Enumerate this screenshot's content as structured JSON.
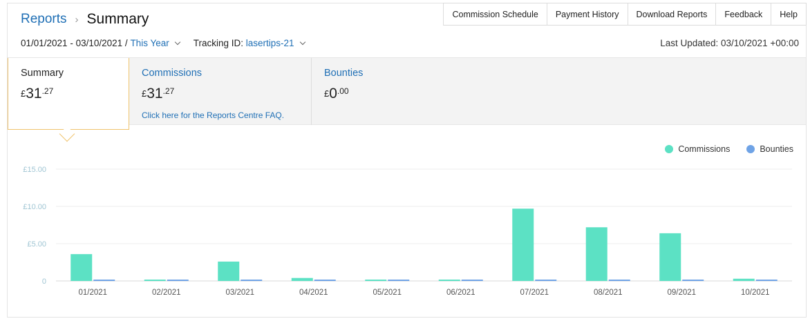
{
  "header": {
    "breadcrumb_link": "Reports",
    "breadcrumb_separator": "›",
    "page_title": "Summary",
    "links": [
      "Commission Schedule",
      "Payment History",
      "Download Reports",
      "Feedback",
      "Help"
    ]
  },
  "filters": {
    "date_range": "01/01/2021 - 03/10/2021",
    "slash": "/",
    "period_label": "This Year",
    "tracking_label": "Tracking ID:",
    "tracking_id": "lasertips-21",
    "last_updated": "Last Updated: 03/10/2021 +00:00"
  },
  "tabs": {
    "summary": {
      "label": "Summary",
      "currency": "£",
      "whole": "31",
      "frac": ".27"
    },
    "commissions": {
      "label": "Commissions",
      "currency": "£",
      "whole": "31",
      "frac": ".27",
      "faq": "Click here for the Reports Centre FAQ."
    },
    "bounties": {
      "label": "Bounties",
      "currency": "£",
      "whole": "0",
      "frac": ".00"
    }
  },
  "colors": {
    "commissions": "#5ce1c4",
    "bounties": "#6fa3e6",
    "accent": "#f0c36d",
    "link": "#1f6fb5"
  },
  "chart_data": {
    "type": "bar",
    "categories": [
      "01/2021",
      "02/2021",
      "03/2021",
      "04/2021",
      "05/2021",
      "06/2021",
      "07/2021",
      "08/2021",
      "09/2021",
      "10/2021"
    ],
    "series": [
      {
        "name": "Commissions",
        "values": [
          3.6,
          0.1,
          2.6,
          0.4,
          0.1,
          0.1,
          9.7,
          7.2,
          6.4,
          0.3
        ]
      },
      {
        "name": "Bounties",
        "values": [
          0.1,
          0.1,
          0.1,
          0.1,
          0.1,
          0.1,
          0.1,
          0.1,
          0.1,
          0.1
        ]
      }
    ],
    "y_ticks": [
      0,
      5,
      10,
      15
    ],
    "y_tick_labels": [
      "0",
      "£5.00",
      "£10.00",
      "£15.00"
    ],
    "ylim": [
      0,
      15
    ],
    "grid": true,
    "legend": "top-right"
  }
}
